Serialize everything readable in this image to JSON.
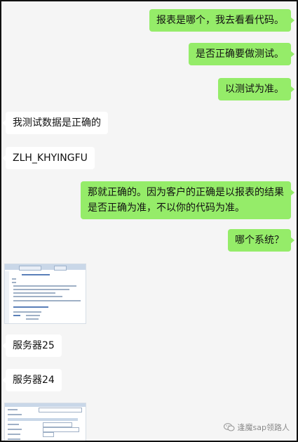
{
  "chat": {
    "messages": [
      {
        "side": "right",
        "text": "报表是哪个，我去看看代码。"
      },
      {
        "side": "right",
        "text": "是否正确要做测试。"
      },
      {
        "side": "right",
        "text": "以测试为准。"
      },
      {
        "side": "left",
        "text": "我测试数据是正确的"
      },
      {
        "side": "left",
        "text": "ZLH_KHYINGFU"
      },
      {
        "side": "right",
        "text_line1": "那就正确的。因为客户的正确是以报表的结果",
        "text_line2": "是否正确为准，不以你的代码为准。"
      },
      {
        "side": "right",
        "text": "哪个系统？"
      },
      {
        "side": "left",
        "text": "服务器25"
      },
      {
        "side": "left",
        "text": "服务器24"
      }
    ]
  },
  "watermark": {
    "text": "逢魔sap领路人",
    "icon": "wechat-icon"
  },
  "colors": {
    "outgoing_bubble": "#95ec69",
    "incoming_bubble": "#ffffff",
    "background": "#f5f5f5"
  }
}
